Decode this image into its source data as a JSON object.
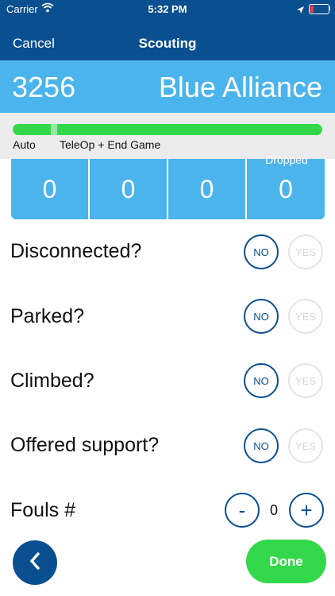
{
  "status_bar": {
    "carrier": "Carrier",
    "time": "5:32 PM"
  },
  "nav": {
    "cancel_label": "Cancel",
    "title": "Scouting"
  },
  "team": {
    "number": "3256",
    "alliance": "Blue Alliance"
  },
  "phase": {
    "auto_label": "Auto",
    "teleop_label": "TeleOp + End Game",
    "progress_fraction": 0.13
  },
  "counters": {
    "dropped_label": "Dropped",
    "values": [
      "0",
      "0",
      "0",
      "0"
    ]
  },
  "questions": [
    {
      "label": "Disconnected?",
      "no": "NO",
      "yes": "YES",
      "selected": "NO"
    },
    {
      "label": "Parked?",
      "no": "NO",
      "yes": "YES",
      "selected": "NO"
    },
    {
      "label": "Climbed?",
      "no": "NO",
      "yes": "YES",
      "selected": "NO"
    },
    {
      "label": "Offered support?",
      "no": "NO",
      "yes": "YES",
      "selected": "NO"
    }
  ],
  "fouls": {
    "label": "Fouls #",
    "value": "0",
    "minus": "-",
    "plus": "+"
  },
  "footer": {
    "done_label": "Done"
  },
  "colors": {
    "nav_blue": "#0a4f8f",
    "alliance_blue": "#4bb4ec",
    "green": "#33d84a"
  },
  "icons": [
    "wifi-icon",
    "location-icon",
    "battery-icon",
    "chevron-left-icon"
  ]
}
